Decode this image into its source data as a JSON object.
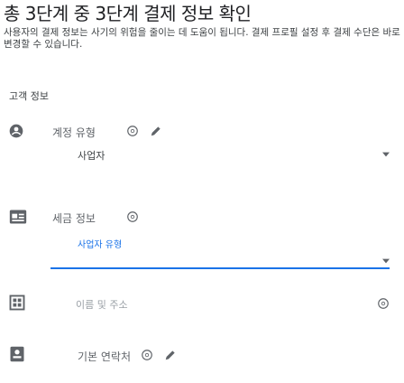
{
  "header": {
    "title": "총 3단계 중 3단계 결제 정보 확인",
    "description": "사용자의 결제 정보는 사기의 위험을 줄이는 데 도움이 됩니다. 결제 프로필 설정 후 결제 수단은 바로 변경할 수 있습니다."
  },
  "section": {
    "title": "고객 정보"
  },
  "rows": {
    "customer_type": {
      "label": "계정 유형",
      "value": "사업자"
    },
    "tax_info": {
      "label": "세금 정보",
      "hint": "사업자 유형"
    },
    "name_address": {
      "label": "이름 및 주소"
    },
    "contact": {
      "label": "기본 연락처"
    }
  },
  "colors": {
    "accent": "#1a73e8",
    "icon": "#5f6368",
    "text": "#202124"
  }
}
